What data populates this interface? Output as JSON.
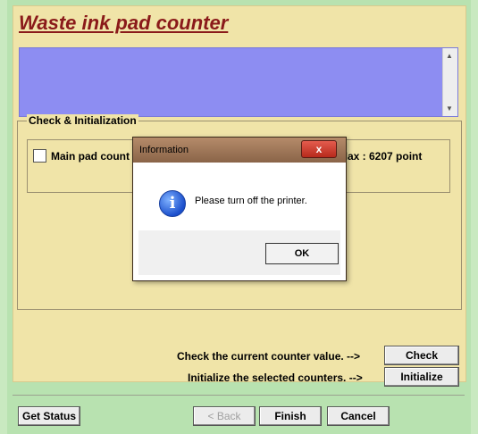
{
  "header": {
    "title": "Waste ink pad counter"
  },
  "status_box": {
    "text": "",
    "scroll_up": "▲",
    "scroll_down": "▼"
  },
  "check_group": {
    "legend": "Check & Initialization",
    "main_pad_label": "Main pad count",
    "max_label": "Max : 6207 point",
    "check_prompt": "Check the current counter value. -->",
    "init_prompt": "Initialize the selected counters. -->",
    "check_button": "Check",
    "initialize_button": "Initialize"
  },
  "bottom_bar": {
    "get_status": "Get Status",
    "back": "< Back",
    "finish": "Finish",
    "cancel": "Cancel"
  },
  "dialog": {
    "title": "Information",
    "close_glyph": "x",
    "icon_glyph": "i",
    "message": "Please turn off the printer.",
    "ok": "OK"
  }
}
